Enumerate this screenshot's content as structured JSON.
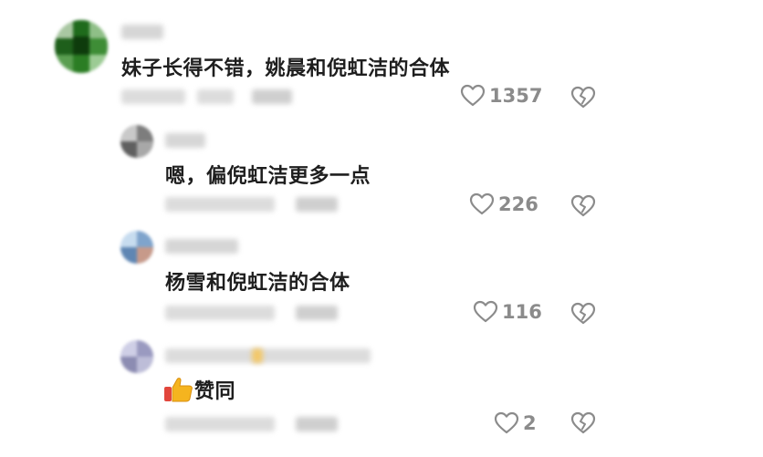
{
  "comments": [
    {
      "text": "妹子长得不错，姚晨和倪虹洁的合体",
      "like_count": "1357",
      "is_reply": false
    },
    {
      "text": "嗯，偏倪虹洁更多一点",
      "like_count": "226",
      "is_reply": true
    },
    {
      "text": "杨雪和倪虹洁的合体",
      "like_count": "116",
      "is_reply": true
    },
    {
      "text": "赞同",
      "emoji": "thumbs-up",
      "like_count": "2",
      "is_reply": true
    }
  ],
  "icons": {
    "like": "heart-outline-icon",
    "dislike": "broken-heart-icon"
  },
  "colors": {
    "icon_gray": "#8b8b8b",
    "text": "#1e1e1e"
  }
}
